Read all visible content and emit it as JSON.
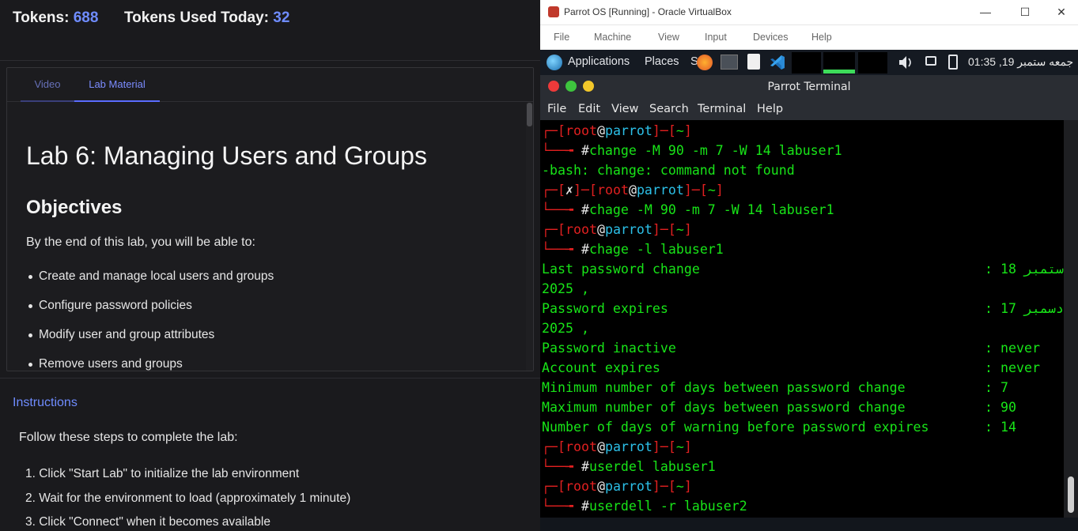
{
  "left": {
    "tokens_label": "Tokens:",
    "tokens_value": "688",
    "used_label": "Tokens Used Today:",
    "used_value": "32",
    "tabs": [
      "Video",
      "Lab Material"
    ],
    "lab_title": "Lab 6: Managing Users and Groups",
    "objectives_heading": "Objectives",
    "objectives_intro": "By the end of this lab, you will be able to:",
    "objectives": [
      "Create and manage local users and groups",
      "Configure password policies",
      "Modify user and group attributes",
      "Remove users and groups"
    ],
    "instructions_title": "Instructions",
    "instructions_lead": "Follow these steps to complete the lab:",
    "steps": [
      "1. Click \"Start Lab\" to initialize the lab environment",
      "2. Wait for the environment to load (approximately 1 minute)",
      "3. Click \"Connect\" when it becomes available"
    ]
  },
  "vbox": {
    "title": "Parrot OS [Running] - Oracle VirtualBox",
    "window_controls": [
      "—",
      "☐",
      "✕"
    ],
    "menu": [
      "File",
      "Machine",
      "View",
      "Input",
      "Devices",
      "Help"
    ]
  },
  "panel": {
    "applications": "Applications",
    "places": "Places",
    "system": "S",
    "clock": "جمعه ستمبر 19, 01:35"
  },
  "terminal": {
    "title": "Parrot Terminal",
    "menu": [
      "File",
      "Edit",
      "View",
      "Search",
      "Terminal",
      "Help"
    ],
    "prompt": {
      "user": "root",
      "at": "@",
      "host": "parrot",
      "dir": "~",
      "hash": "#",
      "fail_mark": "✗"
    },
    "cmd1": "change -M 90 -m 7 -W 14 labuser1",
    "err1": "-bash: change: command not found",
    "cmd2": "chage -M 90 -m 7 -W 14 labuser1",
    "cmd3": "chage -l labuser1",
    "out": {
      "last_change_label": "Last password change",
      "last_change_value": ": 18 ستمبر",
      "last_change_year": "2025 ,",
      "expires_label": "Password expires",
      "expires_value": ": 17 دسمبر",
      "expires_year": "2025 ,",
      "inactive_label": "Password inactive",
      "inactive_value": ": never",
      "acct_label": "Account expires",
      "acct_value": ": never",
      "min_label": "Minimum number of days between password change",
      "min_value": ": 7",
      "max_label": "Maximum number of days between password change",
      "max_value": ": 90",
      "warn_label": "Number of days of warning before password expires",
      "warn_value": ": 14"
    },
    "cmd4": "userdel labuser1",
    "cmd5": "userdell -r labuser2"
  },
  "colors": {
    "accent": "#6f8cff",
    "terminal_green": "#18e418",
    "prompt_red": "#e12020",
    "prompt_cyan": "#2cc0e8"
  }
}
